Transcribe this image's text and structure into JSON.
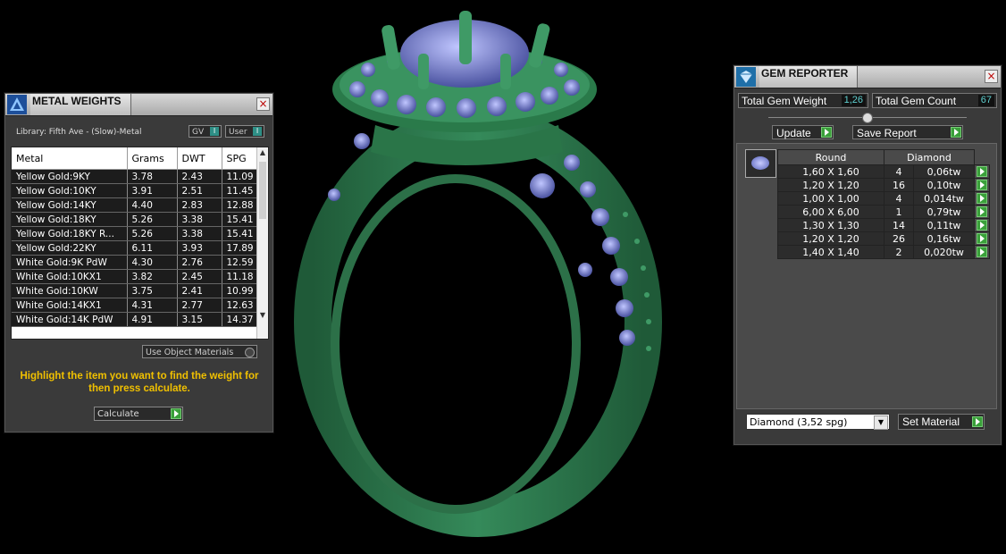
{
  "metal_weights": {
    "title": "METAL WEIGHTS",
    "library": "Library: Fifth Ave - (Slow)-Metal",
    "toggles": [
      {
        "label": "GV"
      },
      {
        "label": "User"
      }
    ],
    "columns": [
      "Metal",
      "Grams",
      "DWT",
      "SPG"
    ],
    "rows": [
      [
        "Yellow Gold:9KY",
        "3.78",
        "2.43",
        "11.09"
      ],
      [
        "Yellow Gold:10KY",
        "3.91",
        "2.51",
        "11.45"
      ],
      [
        "Yellow Gold:14KY",
        "4.40",
        "2.83",
        "12.88"
      ],
      [
        "Yellow Gold:18KY",
        "5.26",
        "3.38",
        "15.41"
      ],
      [
        "Yellow Gold:18KY R...",
        "5.26",
        "3.38",
        "15.41"
      ],
      [
        "Yellow Gold:22KY",
        "6.11",
        "3.93",
        "17.89"
      ],
      [
        "White Gold:9K PdW",
        "4.30",
        "2.76",
        "12.59"
      ],
      [
        "White Gold:10KX1",
        "3.82",
        "2.45",
        "11.18"
      ],
      [
        "White Gold:10KW",
        "3.75",
        "2.41",
        "10.99"
      ],
      [
        "White Gold:14KX1",
        "4.31",
        "2.77",
        "12.63"
      ],
      [
        "White Gold:14K PdW",
        "4.91",
        "3.15",
        "14.37"
      ]
    ],
    "use_object_materials": "Use Object Materials",
    "hint": "Highlight the item you want to find the weight for then press calculate.",
    "calculate_label": "Calculate"
  },
  "gem_reporter": {
    "title": "GEM REPORTER",
    "total_weight_label": "Total Gem Weight",
    "total_weight": "1,26",
    "total_count_label": "Total Gem Count",
    "total_count": "67",
    "update_label": "Update",
    "save_label": "Save Report",
    "headers": [
      "Round",
      "Diamond"
    ],
    "rows": [
      [
        "1,60 X 1,60",
        "4",
        "0,06tw"
      ],
      [
        "1,20 X 1,20",
        "16",
        "0,10tw"
      ],
      [
        "1,00 X 1,00",
        "4",
        "0,014tw"
      ],
      [
        "6,00 X 6,00",
        "1",
        "0,79tw"
      ],
      [
        "1,30 X 1,30",
        "14",
        "0,11tw"
      ],
      [
        "1,20 X 1,20",
        "26",
        "0,16tw"
      ],
      [
        "1,40 X 1,40",
        "2",
        "0,020tw"
      ]
    ],
    "material_select": "Diamond     (3,52 spg)",
    "set_material_label": "Set Material"
  },
  "colors": {
    "ring": "#2e7d4f",
    "gem": "#8088d0",
    "hint": "#f0c000"
  },
  "icons": [
    "close-icon",
    "play-arrow-icon",
    "dropdown-arrow-icon",
    "gem-thumbnail-icon"
  ]
}
